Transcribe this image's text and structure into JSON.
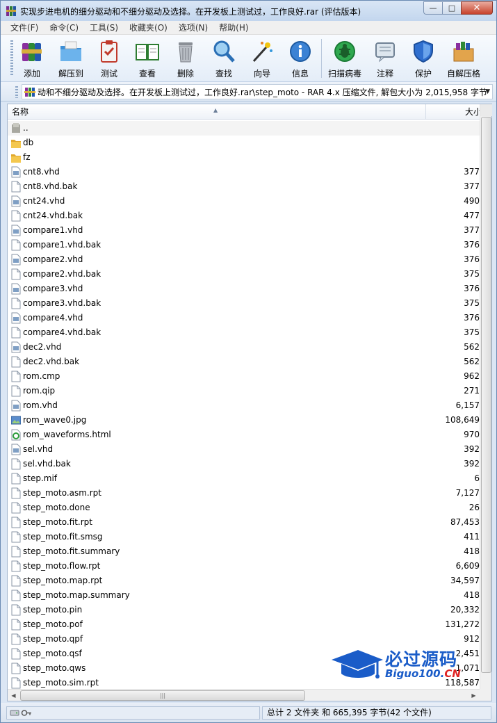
{
  "window": {
    "title": "实现步进电机的细分驱动和不细分驱动及选择。在开发板上测试过，工作良好.rar (评估版本)",
    "controls": {
      "minimize": "—",
      "maximize": "□",
      "close": "✕"
    }
  },
  "menu": [
    "文件(F)",
    "命令(C)",
    "工具(S)",
    "收藏夹(O)",
    "选项(N)",
    "帮助(H)"
  ],
  "toolbar": {
    "add": "添加",
    "extract": "解压到",
    "test": "测试",
    "view": "查看",
    "delete": "删除",
    "find": "查找",
    "wizard": "向导",
    "info": "信息",
    "virus": "扫描病毒",
    "comment": "注释",
    "protect": "保护",
    "sfx": "自解压格"
  },
  "address": {
    "path": "动和不细分驱动及选择。在开发板上测试过，工作良好.rar\\step_moto - RAR 4.x 压缩文件, 解包大小为 2,015,958 字节"
  },
  "columns": {
    "name": "名称",
    "size": "大小"
  },
  "files": [
    {
      "name": "..",
      "size": "",
      "type": "up"
    },
    {
      "name": "db",
      "size": "",
      "type": "folder"
    },
    {
      "name": "fz",
      "size": "",
      "type": "folder"
    },
    {
      "name": "cnt8.vhd",
      "size": "377",
      "type": "vhd"
    },
    {
      "name": "cnt8.vhd.bak",
      "size": "377",
      "type": "file"
    },
    {
      "name": "cnt24.vhd",
      "size": "490",
      "type": "vhd"
    },
    {
      "name": "cnt24.vhd.bak",
      "size": "477",
      "type": "file"
    },
    {
      "name": "compare1.vhd",
      "size": "377",
      "type": "vhd"
    },
    {
      "name": "compare1.vhd.bak",
      "size": "376",
      "type": "file"
    },
    {
      "name": "compare2.vhd",
      "size": "376",
      "type": "vhd"
    },
    {
      "name": "compare2.vhd.bak",
      "size": "375",
      "type": "file"
    },
    {
      "name": "compare3.vhd",
      "size": "376",
      "type": "vhd"
    },
    {
      "name": "compare3.vhd.bak",
      "size": "375",
      "type": "file"
    },
    {
      "name": "compare4.vhd",
      "size": "376",
      "type": "vhd"
    },
    {
      "name": "compare4.vhd.bak",
      "size": "375",
      "type": "file"
    },
    {
      "name": "dec2.vhd",
      "size": "562",
      "type": "vhd"
    },
    {
      "name": "dec2.vhd.bak",
      "size": "562",
      "type": "file"
    },
    {
      "name": "rom.cmp",
      "size": "962",
      "type": "file"
    },
    {
      "name": "rom.qip",
      "size": "271",
      "type": "file"
    },
    {
      "name": "rom.vhd",
      "size": "6,157",
      "type": "vhd"
    },
    {
      "name": "rom_wave0.jpg",
      "size": "108,649",
      "type": "jpg"
    },
    {
      "name": "rom_waveforms.html",
      "size": "970",
      "type": "html"
    },
    {
      "name": "sel.vhd",
      "size": "392",
      "type": "vhd"
    },
    {
      "name": "sel.vhd.bak",
      "size": "392",
      "type": "file"
    },
    {
      "name": "step.mif",
      "size": "6",
      "type": "file"
    },
    {
      "name": "step_moto.asm.rpt",
      "size": "7,127",
      "type": "file"
    },
    {
      "name": "step_moto.done",
      "size": "26",
      "type": "file"
    },
    {
      "name": "step_moto.fit.rpt",
      "size": "87,453",
      "type": "file"
    },
    {
      "name": "step_moto.fit.smsg",
      "size": "411",
      "type": "file"
    },
    {
      "name": "step_moto.fit.summary",
      "size": "418",
      "type": "file"
    },
    {
      "name": "step_moto.flow.rpt",
      "size": "6,609",
      "type": "file"
    },
    {
      "name": "step_moto.map.rpt",
      "size": "34,597",
      "type": "file"
    },
    {
      "name": "step_moto.map.summary",
      "size": "418",
      "type": "file"
    },
    {
      "name": "step_moto.pin",
      "size": "20,332",
      "type": "file"
    },
    {
      "name": "step_moto.pof",
      "size": "131,272",
      "type": "file"
    },
    {
      "name": "step_moto.qpf",
      "size": "912",
      "type": "file"
    },
    {
      "name": "step_moto.qsf",
      "size": "2,451",
      "type": "file"
    },
    {
      "name": "step_moto.qws",
      "size": "1,071",
      "type": "file"
    },
    {
      "name": "step_moto.sim.rpt",
      "size": "118,587",
      "type": "file"
    }
  ],
  "status": {
    "summary": "总计 2 文件夹 和 665,395 字节(42 个文件)"
  },
  "watermark": {
    "title": "必过源码",
    "sub_main": "Biguo100.",
    "sub_cn": "CN"
  }
}
